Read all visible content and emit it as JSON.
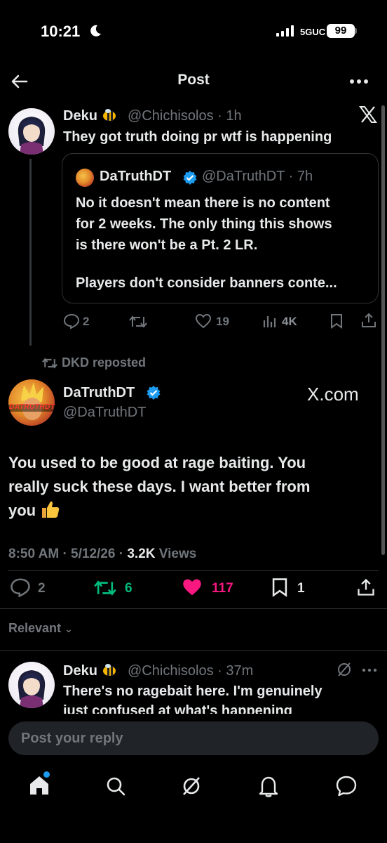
{
  "status_bar": {
    "time": "10:21",
    "network": "5GUC",
    "battery": "99"
  },
  "header": {
    "title": "Post"
  },
  "parent_tweet": {
    "name": "Deku",
    "handle": "@Chichisolos",
    "time": "· 1h",
    "text": "They got truth doing pr wtf is happening",
    "quote": {
      "name": "DaTruthDT",
      "handle": "@DaTruthDT",
      "time": "· 7h",
      "text_line1": "No it doesn't mean there is no content",
      "text_line2": "for 2 weeks. The only thing this shows",
      "text_line3": "is there won't be a Pt. 2 LR.",
      "text_line4": "Players don't consider banners conte..."
    },
    "actions": {
      "replies": "2",
      "likes": "19",
      "views": "4K"
    }
  },
  "repost_label": "DKD reposted",
  "main_tweet": {
    "name": "DaTruthDT",
    "handle": "@DaTruthDT",
    "watermark": "X.com",
    "avatar_text": "DATRUTHDT",
    "text_line1": "You used to be good at rage baiting. You",
    "text_line2": "really suck these days. I want better from",
    "text_line3": "you",
    "time": "8:50 AM",
    "date": "5/12/26",
    "views_count": "3.2K",
    "views_label": "Views",
    "actions": {
      "replies": "2",
      "reposts": "6",
      "likes": "117",
      "bookmarks": "1"
    }
  },
  "sort": {
    "label": "Relevant"
  },
  "reply_tweet": {
    "name": "Deku",
    "handle": "@Chichisolos",
    "time": "· 37m",
    "text_line1": "There's no ragebait here. I'm genuinely",
    "text_line2": "just confused at what's happening"
  },
  "reply_input": {
    "placeholder": "Post your reply"
  },
  "colors": {
    "accent": "#1d9bf0",
    "like": "#f91880",
    "repost": "#00ba7c",
    "muted": "#71767b"
  },
  "icons": [
    "back-arrow-icon",
    "more-icon",
    "x-logo-icon",
    "verified-icon",
    "reply-icon",
    "repost-icon",
    "like-icon",
    "views-icon",
    "bookmark-icon",
    "share-icon",
    "home-icon",
    "search-icon",
    "grok-icon",
    "notifications-icon",
    "messages-icon"
  ]
}
